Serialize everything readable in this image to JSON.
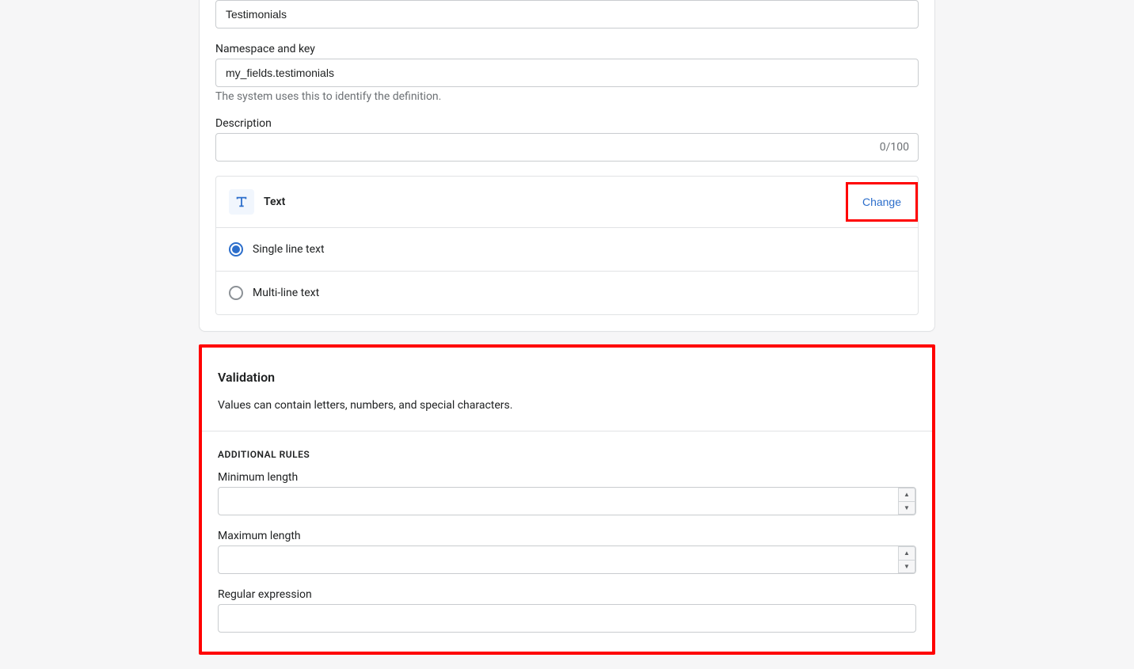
{
  "nameField": {
    "value": "Testimonials"
  },
  "namespace": {
    "label": "Namespace and key",
    "value": "my_fields.testimonials",
    "help": "The system uses this to identify the definition."
  },
  "description": {
    "label": "Description",
    "counter": "0/100",
    "value": ""
  },
  "contentType": {
    "icon": "text-icon",
    "name": "Text",
    "changeLabel": "Change",
    "options": [
      {
        "label": "Single line text",
        "selected": true
      },
      {
        "label": "Multi-line text",
        "selected": false
      }
    ]
  },
  "validation": {
    "title": "Validation",
    "description": "Values can contain letters, numbers, and special characters.",
    "rulesHeading": "ADDITIONAL RULES",
    "minLabel": "Minimum length",
    "minValue": "",
    "maxLabel": "Maximum length",
    "maxValue": "",
    "regexLabel": "Regular expression",
    "regexValue": ""
  }
}
